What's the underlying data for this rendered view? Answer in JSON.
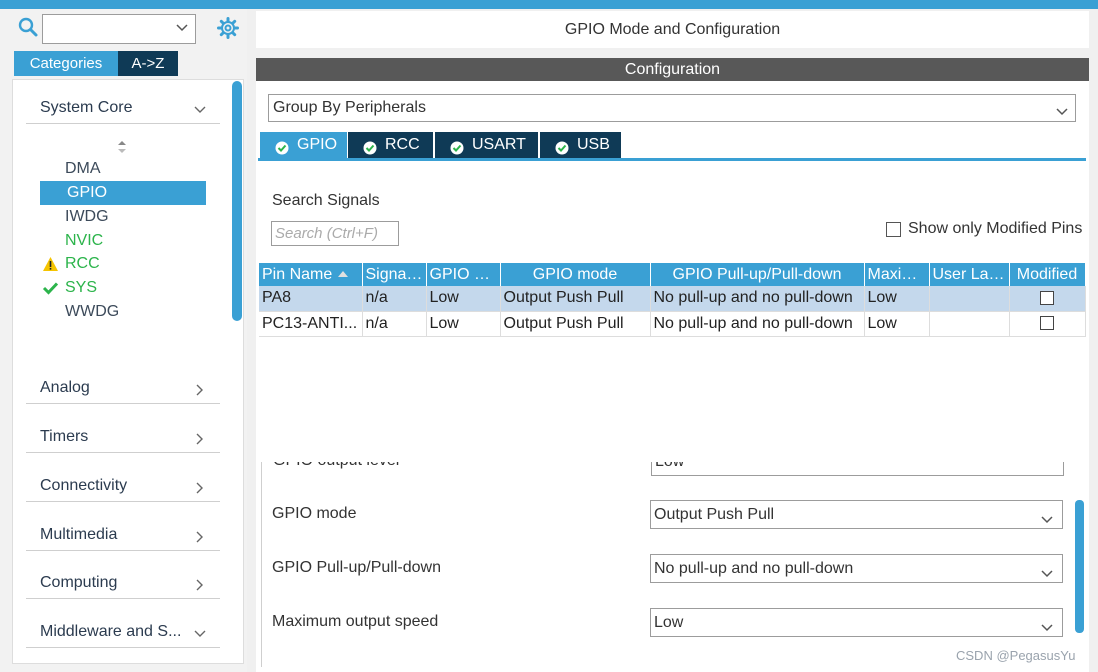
{
  "colors": {
    "accent": "#3aa0d4",
    "dark_tab": "#0f3a56",
    "header_gray": "#585858",
    "ok_green": "#2cb44b",
    "warn_yellow": "#f5c400"
  },
  "sidebar": {
    "search_icon": "search-icon",
    "settings_icon": "gear-icon",
    "tabs": {
      "categories": "Categories",
      "a_to_z": "A->Z"
    },
    "system_core": {
      "label": "System Core",
      "items": [
        {
          "label": "DMA",
          "status": "none"
        },
        {
          "label": "GPIO",
          "status": "selected"
        },
        {
          "label": "IWDG",
          "status": "none"
        },
        {
          "label": "NVIC",
          "status": "ok-text"
        },
        {
          "label": "RCC",
          "status": "warning"
        },
        {
          "label": "SYS",
          "status": "ok"
        },
        {
          "label": "WWDG",
          "status": "none"
        }
      ]
    },
    "categories": [
      {
        "label": "Analog"
      },
      {
        "label": "Timers"
      },
      {
        "label": "Connectivity"
      },
      {
        "label": "Multimedia"
      },
      {
        "label": "Computing"
      },
      {
        "label": "Middleware and S..."
      }
    ]
  },
  "main": {
    "title": "GPIO Mode and Configuration",
    "config_header": "Configuration",
    "group_by": "Group By Peripherals",
    "peripheral_tabs": [
      "GPIO",
      "RCC",
      "USART",
      "USB"
    ],
    "active_tab": "GPIO",
    "search": {
      "label": "Search Signals",
      "placeholder": "Search (Ctrl+F)"
    },
    "show_modified": {
      "label": "Show only Modified Pins",
      "checked": false
    },
    "table": {
      "columns": [
        "Pin Name",
        "Signal ...",
        "GPIO ou...",
        "GPIO mode",
        "GPIO Pull-up/Pull-down",
        "Maxim...",
        "User Lab...",
        "Modified"
      ],
      "rows": [
        {
          "pin": "PA8",
          "signal": "n/a",
          "level": "Low",
          "mode": "Output Push Pull",
          "pull": "No pull-up and no pull-down",
          "speed": "Low",
          "user_label": "",
          "modified": false
        },
        {
          "pin": "PC13-ANTI...",
          "signal": "n/a",
          "level": "Low",
          "mode": "Output Push Pull",
          "pull": "No pull-up and no pull-down",
          "speed": "Low",
          "user_label": "",
          "modified": false
        }
      ]
    },
    "pin_config": {
      "rows": [
        {
          "label": "GPIO output level",
          "value": "Low"
        },
        {
          "label": "GPIO mode",
          "value": "Output Push Pull"
        },
        {
          "label": "GPIO Pull-up/Pull-down",
          "value": "No pull-up and no pull-down"
        },
        {
          "label": "Maximum output speed",
          "value": "Low"
        }
      ]
    }
  },
  "watermark": "CSDN @PegasusYu"
}
